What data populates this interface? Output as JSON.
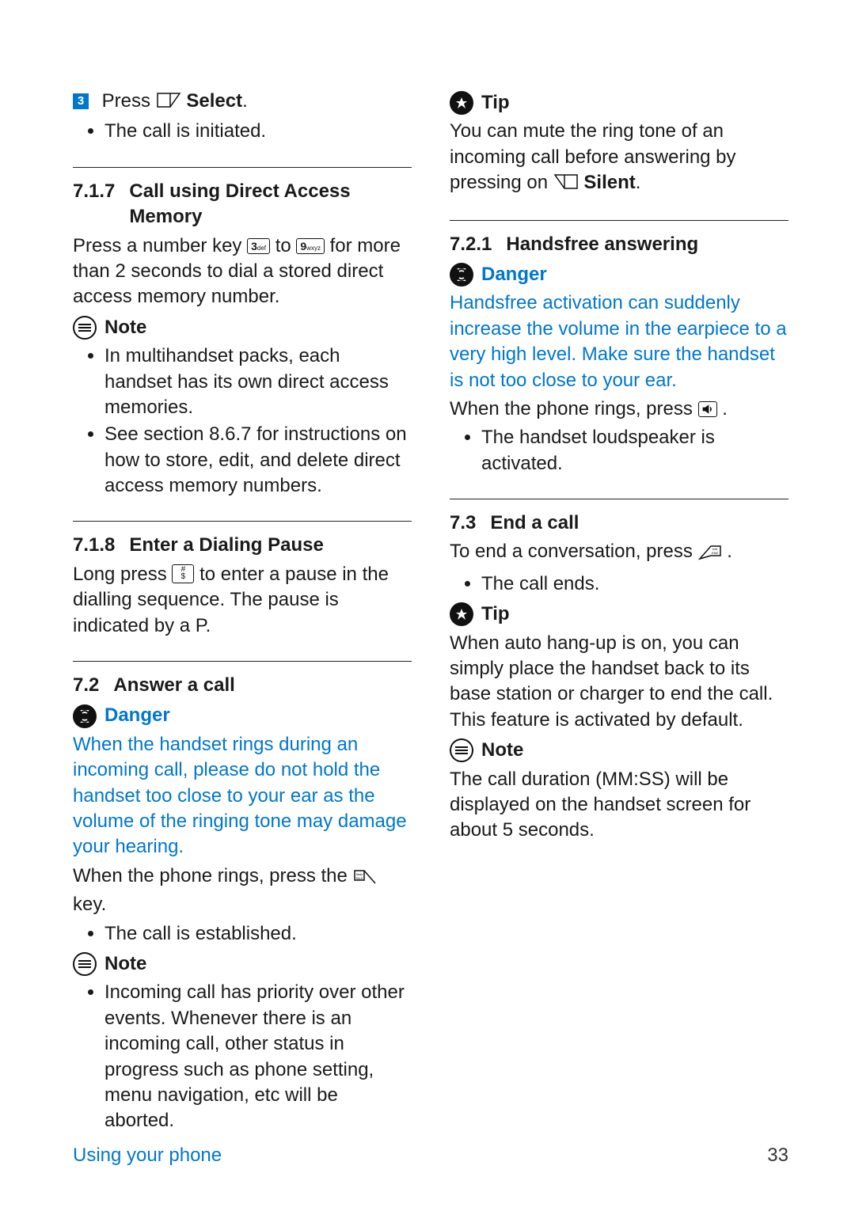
{
  "col1": {
    "step3_badge": "3",
    "step3_text_a": "Press ",
    "step3_bold": "Select",
    "step3_punct": ".",
    "step3_bullet": "The call is initiated.",
    "h717_num": "7.1.7",
    "h717_title": "Call using Direct Access Memory",
    "p717_a": "Press a number key ",
    "p717_b": " to ",
    "p717_c": " for more than 2 seconds to dial a stored direct access memory number.",
    "key3": "3def",
    "key9": "9wxyz",
    "note_label": "Note",
    "note717_b1": "In multihandset packs, each handset has its own direct access memories.",
    "note717_b2": "See section 8.6.7 for instructions on how to store, edit, and delete direct access memory numbers.",
    "h718_num": "7.1.8",
    "h718_title": "Enter a Dialing Pause",
    "p718_a": "Long press ",
    "key_hash": "#\n$",
    "p718_b": " to enter a pause in the dialling sequence. The pause is indicated by a P.",
    "h72_num": "7.2",
    "h72_title": "Answer a call",
    "danger_label": "Danger",
    "danger72_text": "When the handset rings during an incoming call, please do not hold the handset too close to your ear as the volume of the ringing tone may damage your hearing.",
    "p72_a": "When the phone rings, press the ",
    "p72_b": " key.",
    "p72_bullet": "The call is established.",
    "note72_b1": "Incoming call has priority over other events. Whenever there is an incoming call, other status in progress such as phone setting, menu navigation, etc will be aborted."
  },
  "col2": {
    "tip_label": "Tip",
    "tip72_a": "You can mute the ring tone of an incoming call before answering by pressing on ",
    "tip72_bold": "Silent",
    "tip72_punct": ".",
    "h721_num": "7.2.1",
    "h721_title": "Handsfree answering",
    "danger_label": "Danger",
    "danger721_text": "Handsfree activation can suddenly increase the volume in the earpiece to a very high level. Make sure the handset is not too close to your ear.",
    "p721_a": "When the phone rings, press ",
    "p721_b": ".",
    "p721_bullet": "The handset loudspeaker is activated.",
    "h73_num": "7.3",
    "h73_title": "End a call",
    "p73_a": "To end a conversation, press ",
    "p73_b": ".",
    "p73_bullet": "The call ends.",
    "tip73_text": "When auto hang-up is on, you can simply place the handset back to its base station or charger to end the call. This feature is activated by default.",
    "note_label": "Note",
    "note73_text": "The call duration (MM:SS) will be displayed on the handset screen for about 5 seconds."
  },
  "footer": {
    "title": "Using your phone",
    "page": "33"
  }
}
